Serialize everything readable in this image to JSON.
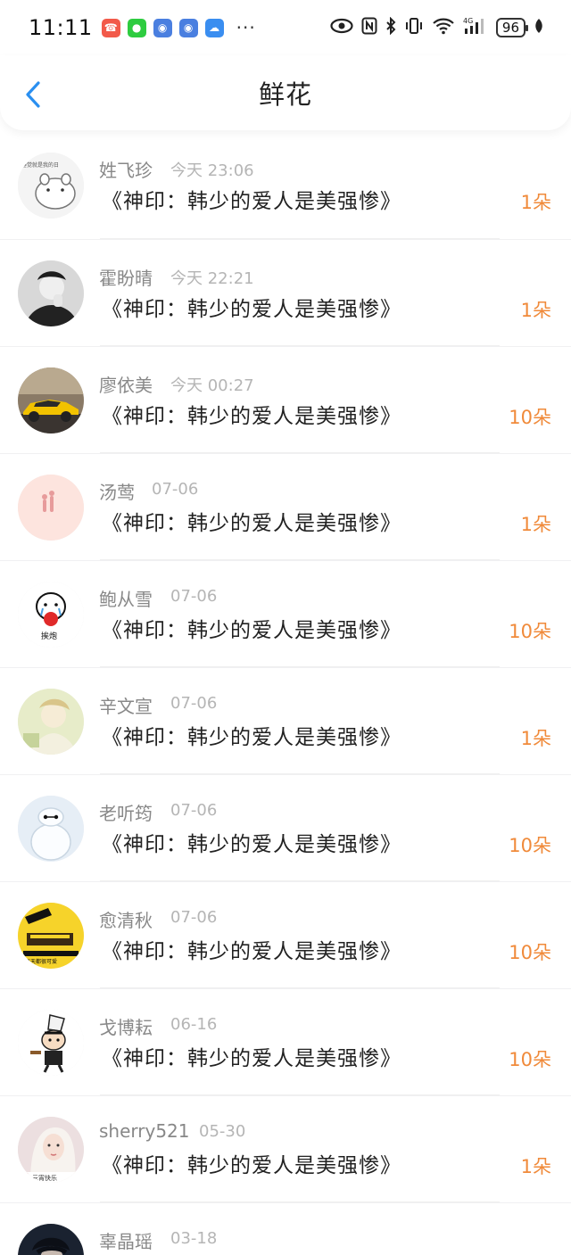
{
  "status_bar": {
    "time": "11:11",
    "battery": "96",
    "dots": "···",
    "app_icons": [
      {
        "name": "missed-call-icon",
        "color": "#f25a4a",
        "glyph": "☎"
      },
      {
        "name": "wechat-icon",
        "color": "#2ecc40",
        "glyph": "●"
      },
      {
        "name": "game-controller-icon",
        "color": "#4a7fe0",
        "glyph": "◉"
      },
      {
        "name": "game-controller-icon-2",
        "color": "#4a7fe0",
        "glyph": "◉"
      },
      {
        "name": "cloud-icon",
        "color": "#3a8ef0",
        "glyph": "☁"
      }
    ]
  },
  "header": {
    "title": "鲜花",
    "accent": "#2a8ff0"
  },
  "colors": {
    "flower_count": "#f08a3a",
    "username": "#888888",
    "date": "#b5b5b5"
  },
  "items": [
    {
      "user": "姓飞珍",
      "date": "今天 23:06",
      "book": "《神印：韩少的爱人是美强惨》",
      "count": "1朵",
      "avatar": "hamster"
    },
    {
      "user": "霍盼晴",
      "date": "今天 22:21",
      "book": "《神印：韩少的爱人是美强惨》",
      "count": "1朵",
      "avatar": "person-bw"
    },
    {
      "user": "廖依美",
      "date": "今天 00:27",
      "book": "《神印：韩少的爱人是美强惨》",
      "count": "10朵",
      "avatar": "car"
    },
    {
      "user": "汤莺",
      "date": "07-06",
      "book": "《神印：韩少的爱人是美强惨》",
      "count": "1朵",
      "avatar": "pink"
    },
    {
      "user": "鲍从雪",
      "date": "07-06",
      "book": "《神印：韩少的爱人是美强惨》",
      "count": "10朵",
      "avatar": "cartoon"
    },
    {
      "user": "辛文宣",
      "date": "07-06",
      "book": "《神印：韩少的爱人是美强惨》",
      "count": "1朵",
      "avatar": "anime"
    },
    {
      "user": "老听筠",
      "date": "07-06",
      "book": "《神印：韩少的爱人是美强惨》",
      "count": "10朵",
      "avatar": "baymax"
    },
    {
      "user": "愈清秋",
      "date": "07-06",
      "book": "《神印：韩少的爱人是美强惨》",
      "count": "10朵",
      "avatar": "yellow"
    },
    {
      "user": "戈博耘",
      "date": "06-16",
      "book": "《神印：韩少的爱人是美强惨》",
      "count": "10朵",
      "avatar": "shinchan"
    },
    {
      "user": "sherry521",
      "date": "05-30",
      "book": "《神印：韩少的爱人是美强惨》",
      "count": "1朵",
      "avatar": "girl"
    },
    {
      "user": "辜晶瑶",
      "date": "03-18",
      "book": "",
      "count": "",
      "avatar": "dark"
    }
  ]
}
